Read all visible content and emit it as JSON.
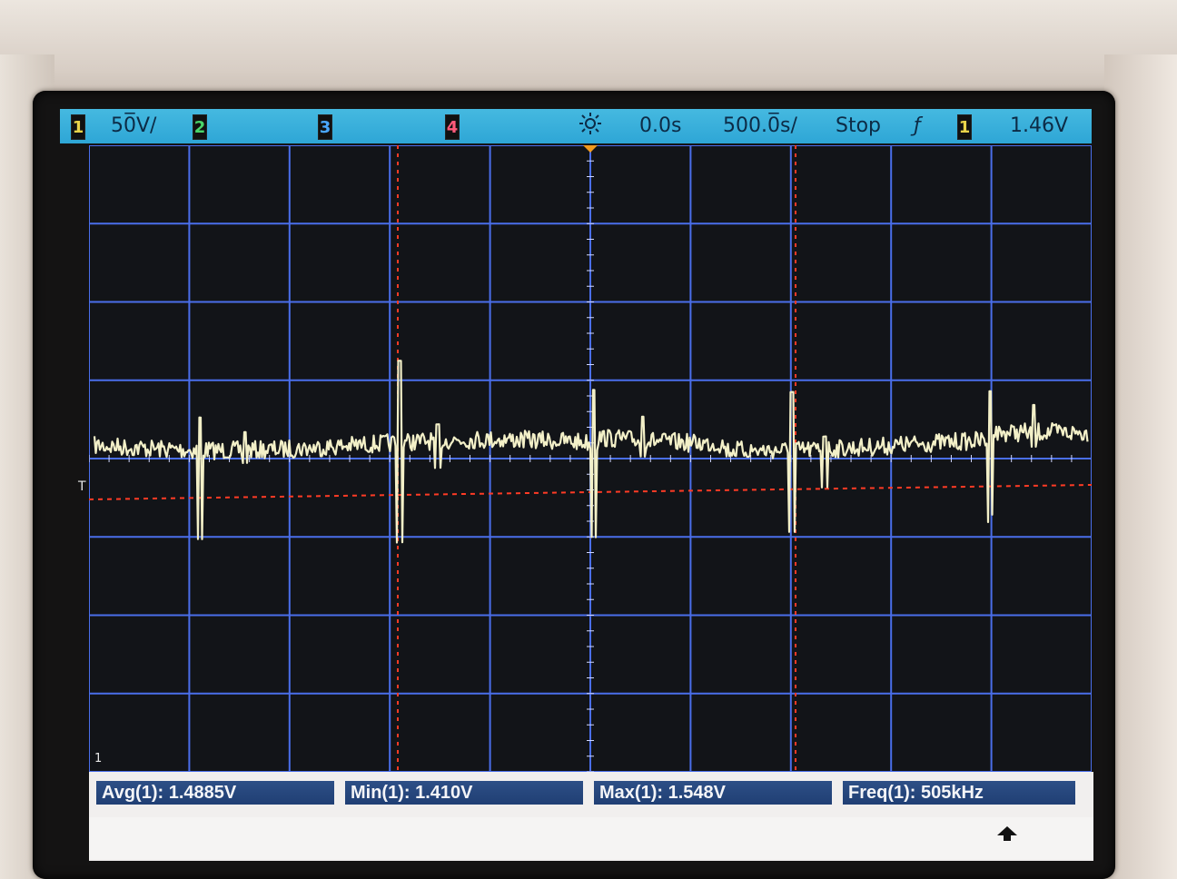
{
  "status_bar": {
    "ch1_label": "1",
    "ch1_scale": "50̅V/",
    "ch2_label": "2",
    "ch3_label": "3",
    "ch4_label": "4",
    "delay": "0.0s",
    "timebase": "500.0̅s/",
    "run_state": "Stop",
    "trigger_edge": "ƒ",
    "trigger_source": "1",
    "trigger_level": "1.46V"
  },
  "measurements": [
    {
      "label": "Avg(1): 1.4885V"
    },
    {
      "label": "Min(1): 1.410V"
    },
    {
      "label": "Max(1): 1.548V"
    },
    {
      "label": "Freq(1): 505kHz"
    }
  ],
  "markers": {
    "trigger_level_marker": "T",
    "ground_marker": "1"
  },
  "colors": {
    "status_bar_bg": "#2ea6d6",
    "trace": "#f3f0c8",
    "cursor": "#ff3b25",
    "grid": "#4a6eea",
    "measure_box": "#203f74"
  }
}
